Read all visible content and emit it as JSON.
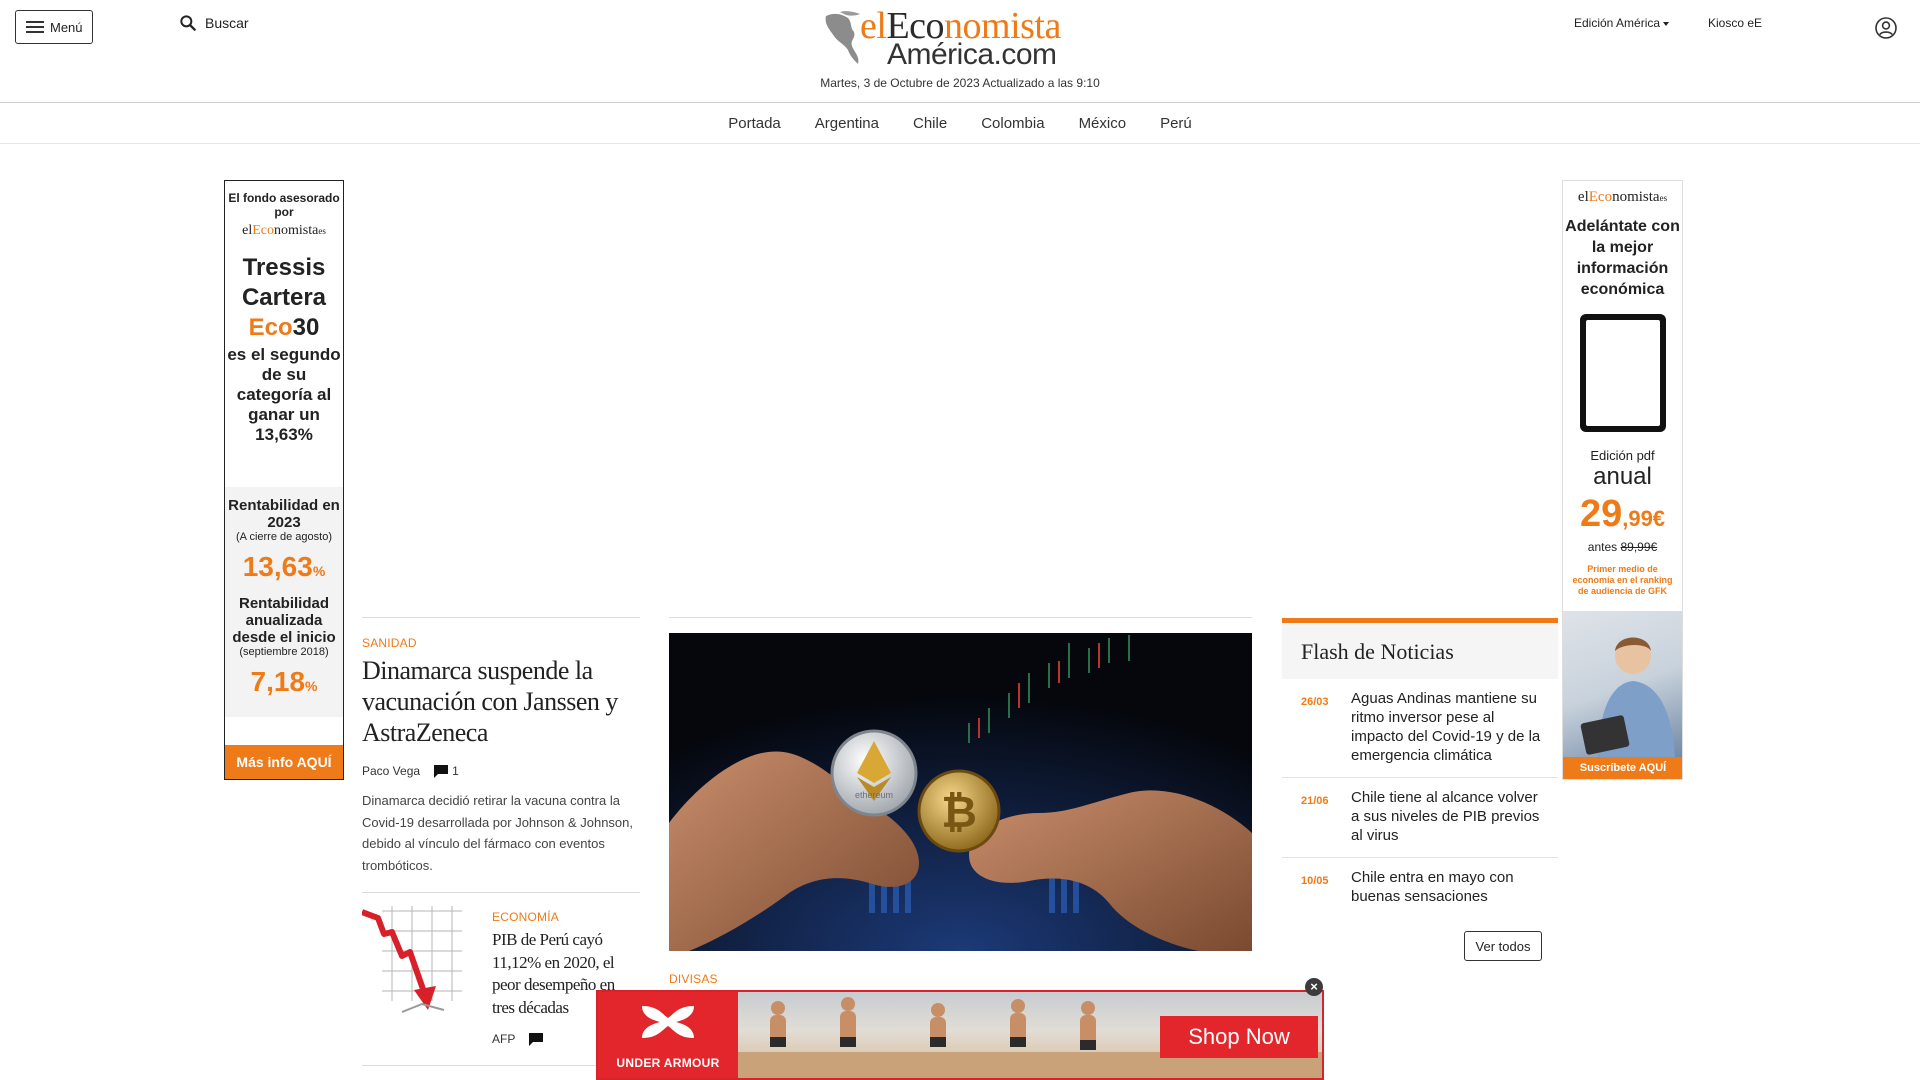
{
  "header": {
    "menu_label": "Menú",
    "search_label": "Buscar",
    "logo": {
      "part1": "el",
      "part2": "Eco",
      "part3": "nomista",
      "line2": "América.com"
    },
    "date": "Martes, 3 de Octubre de 2023 Actualizado a las 9:10",
    "edition_label": "Edición América",
    "kiosco_label": "Kiosco eE"
  },
  "nav": {
    "items": [
      "Portada",
      "Argentina",
      "Chile",
      "Colombia",
      "México",
      "Perú"
    ]
  },
  "ad_left": {
    "top_text": "El fondo asesorado por",
    "brand_a": "el",
    "brand_b": "Eco",
    "brand_c": "nomista",
    "brand_d": "es",
    "fund_1": "Tressis",
    "fund_2": "Cartera",
    "fund_3a": "Eco",
    "fund_3b": "30",
    "claim": "es el segundo de su categoría al ganar un 13,63%",
    "rent1_title": "Rentabilidad en 2023",
    "rent1_sub": "(A cierre de agosto)",
    "rent1_value": "13,63",
    "rent1_unit": "%",
    "rent2_title": "Rentabilidad anualizada desde el inicio",
    "rent2_sub": "(septiembre 2018)",
    "rent2_value": "7,18",
    "rent2_unit": "%",
    "cta": "Más info AQUÍ"
  },
  "ad_right": {
    "brand_a": "el",
    "brand_b": "Eco",
    "brand_c": "nomista",
    "brand_d": "es",
    "headline": "Adelántate con la mejor información económica",
    "edition": "Edición pdf",
    "anual": "anual",
    "price_int": "29",
    "price_dec": ",99€",
    "antes_label": "antes",
    "antes_price": "89,99€",
    "primer": "Primer medio de economía en el ranking de audiencia de GFK",
    "cta": "Suscríbete AQUÍ"
  },
  "article1": {
    "section": "Sanidad",
    "title": "Dinamarca suspende la vacunación con Janssen y AstraZeneca",
    "author": "Paco Vega",
    "comments": "1",
    "summary": "Dinamarca decidió retirar la vacuna contra la Covid-19 desarrollada por Johnson & Johnson, debido al vínculo del fármaco con eventos trombóticos."
  },
  "article2": {
    "section": "Economía",
    "title": "PIB de Perú cayó 11,12% en 2020, el peor desempeño en tres décadas",
    "author": "AFP"
  },
  "main_story": {
    "section": "Divisas",
    "coin_label": "ethereum"
  },
  "flash": {
    "title": "Flash de Noticias",
    "items": [
      {
        "date": "26/03",
        "text": "Aguas Andinas mantiene su ritmo inversor pese al impacto del Covid-19 y de la emergencia climática"
      },
      {
        "date": "21/06",
        "text": "Chile tiene al alcance volver a sus niveles de PIB previos al virus"
      },
      {
        "date": "10/05",
        "text": "Chile entra en mayo con buenas sensaciones"
      }
    ],
    "ver_todos": "Ver todos"
  },
  "ad_bottom": {
    "brand": "UNDER ARMOUR",
    "cta": "Shop Now",
    "close": "×"
  },
  "colors": {
    "accent": "#ee7a18",
    "ad_red": "#e2262c"
  },
  "icons": [
    "menu-icon",
    "search-icon",
    "user-icon",
    "comment-icon",
    "close-icon",
    "caret-down-icon"
  ]
}
